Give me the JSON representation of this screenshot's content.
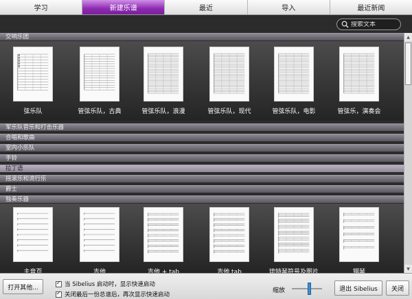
{
  "tabs": [
    {
      "label": "学习",
      "active": false
    },
    {
      "label": "新建乐谱",
      "active": true
    },
    {
      "label": "最近",
      "active": false
    },
    {
      "label": "导入",
      "active": false
    },
    {
      "label": "最近新闻",
      "active": false
    }
  ],
  "search": {
    "placeholder": "搜索文本"
  },
  "sections": {
    "top": "交响乐团",
    "middle": [
      "军乐队音乐和打击乐器",
      "合唱和歌曲",
      "室内小乐队",
      "手铃",
      "拉丁语",
      "摇滚乐和流行乐",
      "爵士"
    ],
    "selected_index": 4,
    "bottom": "独奏乐器"
  },
  "top_items": [
    "弦乐队",
    "管弦乐队，古典",
    "管弦乐队，浪漫",
    "管弦乐队，现代",
    "管弦乐队，电影",
    "管弦乐，演奏会"
  ],
  "bottom_items": [
    "主音页",
    "吉他",
    "吉他 + tab",
    "吉他 tab",
    "琉特琴符号及图片",
    "钢琴"
  ],
  "footer": {
    "open_other": "打开其他...",
    "check1": "当 Sibelius 启动时，显示快速启动",
    "check2": "关闭最后一份总谱后，再次显示快速启动",
    "zoom_label": "缩放",
    "zoom_value": 0.6,
    "exit": "退出 Sibelius",
    "close": "关闭"
  },
  "colors": {
    "active_tab": "#8e2ab0",
    "slider": "#3d8fd1"
  }
}
